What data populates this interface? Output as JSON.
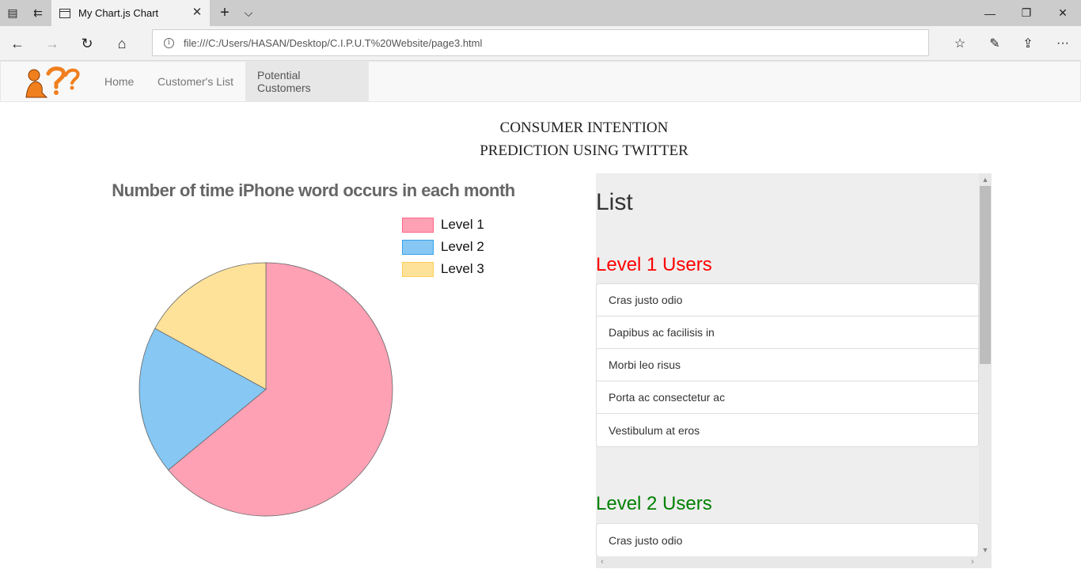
{
  "browser": {
    "tab_title": "My Chart.js Chart",
    "url": "file:///C:/Users/HASAN/Desktop/C.I.P.U.T%20Website/page3.html"
  },
  "navbar": {
    "items": [
      {
        "label": "Home"
      },
      {
        "label": "Customer's List"
      },
      {
        "label": "Potential Customers"
      }
    ],
    "active": "Potential Customers"
  },
  "heading": {
    "line1": "CONSUMER INTENTION",
    "line2": "PREDICTION USING TWITTER"
  },
  "chart_data": {
    "type": "pie",
    "title": "Number of time iPhone word occurs in each month",
    "categories": [
      "Level 1",
      "Level 2",
      "Level 3"
    ],
    "values": [
      64,
      19,
      17
    ],
    "colors": [
      "#ffa1b5",
      "#86c7f3",
      "#ffe29a"
    ],
    "border_colors": [
      "#ff6384",
      "#36a2eb",
      "#ffce56"
    ],
    "legend_position": "top-right"
  },
  "list_panel": {
    "title": "List",
    "levels": [
      {
        "title": "Level 1 Users",
        "color": "#ff0000",
        "items": [
          "Cras justo odio",
          "Dapibus ac facilisis in",
          "Morbi leo risus",
          "Porta ac consectetur ac",
          "Vestibulum at eros"
        ]
      },
      {
        "title": "Level 2 Users",
        "color": "#008000",
        "items": [
          "Cras justo odio"
        ]
      }
    ]
  }
}
